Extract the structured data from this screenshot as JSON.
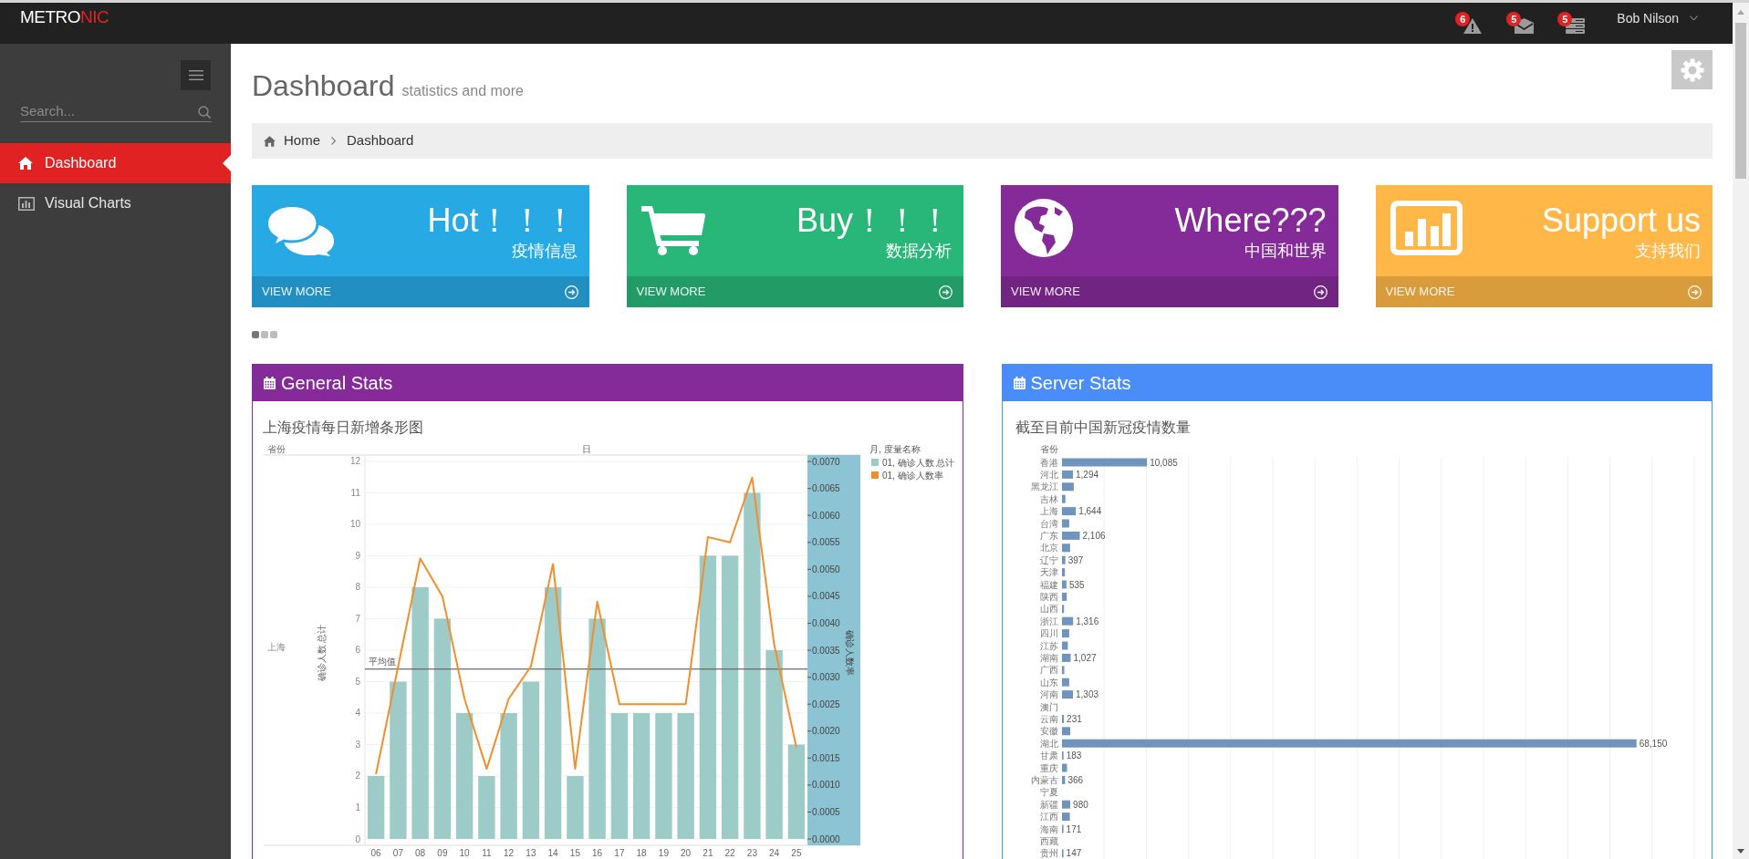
{
  "header": {
    "logo": {
      "main": "METRO",
      "accent": "NIC"
    },
    "notifications": [
      {
        "count": "6"
      },
      {
        "count": "5"
      },
      {
        "count": "5"
      }
    ],
    "user": {
      "name": "Bob Nilson"
    }
  },
  "sidebar": {
    "search": {
      "placeholder": "Search..."
    },
    "menu": [
      {
        "label": "Dashboard",
        "selected": true
      },
      {
        "label": "Visual Charts",
        "selected": false
      }
    ]
  },
  "page_header": {
    "title": "Dashboard",
    "subtitle": "statistics and more"
  },
  "breadcrumb": [
    "Home",
    "Dashboard"
  ],
  "tiles": [
    {
      "title": "Hot！！！",
      "subtitle": "疫情信息",
      "link": "VIEW MORE",
      "color": "#27a9e3"
    },
    {
      "title": "Buy！！！",
      "subtitle": "数据分析",
      "link": "VIEW MORE",
      "color": "#28b779"
    },
    {
      "title": "Where???",
      "subtitle": "中国和世界",
      "link": "VIEW MORE",
      "color": "#852b99"
    },
    {
      "title": "Support us",
      "subtitle": "支持我们",
      "link": "VIEW MORE",
      "color": "#ffb848"
    }
  ],
  "carousel_dots": [
    {
      "selected": true
    },
    {
      "selected": false
    },
    {
      "selected": false
    }
  ],
  "panels": [
    {
      "title": "General Stats",
      "color": "#852b99",
      "row_header": "省份",
      "row_label": "上海",
      "legend_title": "月, 度量名称",
      "chart_data": {
        "type": "bar",
        "title": "上海疫情每日新增条形图",
        "xlabel": "日",
        "ylabel": "确诊人数 总计",
        "categories": [
          "06",
          "07",
          "08",
          "09",
          "10",
          "11",
          "12",
          "13",
          "14",
          "15",
          "16",
          "17",
          "18",
          "19",
          "20",
          "21",
          "22",
          "23",
          "24",
          "25"
        ],
        "series": [
          {
            "name": "01, 确诊人数 总计",
            "type": "bar",
            "color": "#9dcbc7",
            "values": [
              2,
              5,
              8,
              7,
              4,
              2,
              4,
              5,
              8,
              2,
              7,
              4,
              4,
              4,
              4,
              9,
              9,
              11,
              6,
              3
            ]
          },
          {
            "name": "01, 确诊人数率",
            "type": "line",
            "axis": "y2",
            "color": "#f28e2b",
            "values": [
              0.0012,
              0.0032,
              0.0052,
              0.0045,
              0.0026,
              0.0013,
              0.0026,
              0.0032,
              0.0051,
              0.0013,
              0.0044,
              0.0025,
              0.0025,
              0.0025,
              0.0025,
              0.0056,
              0.0055,
              0.0067,
              0.0036,
              0.0017
            ]
          }
        ],
        "ylim": [
          0,
          12.2
        ],
        "yticks": [
          0,
          1,
          2,
          3,
          4,
          5,
          6,
          7,
          8,
          9,
          10,
          11,
          12
        ],
        "y2label": "确诊人数率",
        "y2lim": [
          0,
          0.00712
        ],
        "y2ticks": [
          {
            "value": 0,
            "label": "0.0000"
          },
          {
            "value": 0.0005,
            "label": "0.0005"
          },
          {
            "value": 0.001,
            "label": "0.0010"
          },
          {
            "value": 0.0015,
            "label": "0.0015"
          },
          {
            "value": 0.002,
            "label": "0.0020"
          },
          {
            "value": 0.0025,
            "label": "0.0025"
          },
          {
            "value": 0.003,
            "label": "0.0030"
          },
          {
            "value": 0.0035,
            "label": "0.0035"
          },
          {
            "value": 0.004,
            "label": "0.0040"
          },
          {
            "value": 0.0045,
            "label": "0.0045"
          },
          {
            "value": 0.005,
            "label": "0.0050"
          },
          {
            "value": 0.0055,
            "label": "0.0055"
          },
          {
            "value": 0.006,
            "label": "0.0060"
          },
          {
            "value": 0.0065,
            "label": "0.0065"
          },
          {
            "value": 0.007,
            "label": "0.0070"
          }
        ],
        "grid": true,
        "legend": "right",
        "ref_lines": [
          {
            "axis": "y",
            "value": 5.4,
            "label": "平均值"
          }
        ]
      }
    },
    {
      "title": "Server Stats",
      "color": "#4b8df8",
      "chart_data": {
        "type": "bar",
        "orientation": "horizontal",
        "title": "截至目前中国新冠疫情数量",
        "ylabel": "省份",
        "categories": [
          "香港",
          "河北",
          "黑龙江",
          "吉林",
          "上海",
          "台湾",
          "广东",
          "北京",
          "辽宁",
          "天津",
          "福建",
          "陕西",
          "山西",
          "浙江",
          "四川",
          "江苏",
          "湖南",
          "广西",
          "山东",
          "河南",
          "澳门",
          "云南",
          "安徽",
          "湖北",
          "甘肃",
          "重庆",
          "内蒙古",
          "宁夏",
          "新疆",
          "江西",
          "海南",
          "西藏",
          "贵州"
        ],
        "values": [
          10085,
          1294,
          1400,
          400,
          1644,
          850,
          2106,
          960,
          397,
          350,
          535,
          560,
          240,
          1316,
          850,
          690,
          1027,
          270,
          850,
          1303,
          null,
          231,
          990,
          68150,
          183,
          590,
          366,
          null,
          980,
          935,
          171,
          null,
          147
        ],
        "value_labels": [
          "10,085",
          "1,294",
          null,
          null,
          "1,644",
          null,
          "2,106",
          null,
          "397",
          null,
          "535",
          null,
          null,
          "1,316",
          null,
          null,
          "1,027",
          null,
          null,
          "1,303",
          null,
          "231",
          null,
          "68,150",
          "183",
          null,
          "366",
          null,
          "980",
          null,
          "171",
          null,
          "147"
        ],
        "grid": true
      }
    }
  ]
}
